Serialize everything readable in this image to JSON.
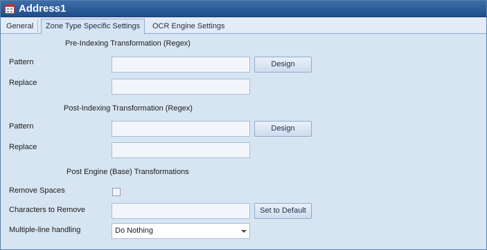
{
  "window": {
    "title": "Address1"
  },
  "tabs": [
    {
      "label": "General"
    },
    {
      "label": "Zone Type Specific Settings"
    },
    {
      "label": "OCR Engine Settings"
    }
  ],
  "pre_indexing": {
    "heading": "Pre-Indexing Transformation (Regex)",
    "pattern_label": "Pattern",
    "pattern_value": "",
    "replace_label": "Replace",
    "replace_value": "",
    "design_button": "Design"
  },
  "post_indexing": {
    "heading": "Post-Indexing Transformation (Regex)",
    "pattern_label": "Pattern",
    "pattern_value": "",
    "replace_label": "Replace",
    "replace_value": "",
    "design_button": "Design"
  },
  "post_engine": {
    "heading": "Post Engine (Base) Transformations",
    "remove_spaces_label": "Remove Spaces",
    "remove_spaces_checked": false,
    "chars_to_remove_label": "Characters to Remove",
    "chars_to_remove_value": "",
    "set_default_button": "Set to Default",
    "multiline_label": "Multiple-line handling",
    "multiline_value": "Do Nothing"
  }
}
